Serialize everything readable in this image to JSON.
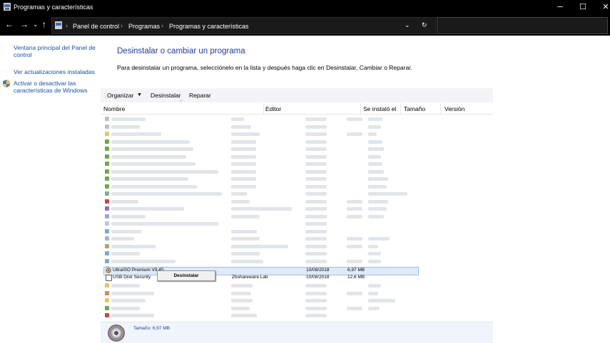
{
  "window": {
    "title": "Programas y características",
    "minimize": "─",
    "maximize": "☐",
    "close": "✕"
  },
  "nav": {
    "back": "←",
    "forward": "→",
    "history": "⌄",
    "up": "↑",
    "refresh": "↻",
    "dropdown": "⌄"
  },
  "breadcrumb": [
    "Panel de control",
    "Programas",
    "Programas y características"
  ],
  "sidebar": {
    "items": [
      {
        "label": "Ventana principal del Panel de",
        "label2": "control"
      },
      {
        "label": "Ver actualizaciones instaladas"
      },
      {
        "label": "Activar o desactivar las",
        "label2": "características de Windows",
        "icon": "shield-icon"
      }
    ]
  },
  "main": {
    "heading": "Desinstalar o cambiar un programa",
    "subtitle": "Para desinstalar un programa, selecciónelo en la lista y después haga clic en Desinstalar, Cambiar o Reparar."
  },
  "toolbar": {
    "organize": "Organizar",
    "uninstall": "Desinstalar",
    "repair": "Reparar"
  },
  "columns": {
    "name": "Nombre",
    "publisher": "Editor",
    "installed": "Se instaló el",
    "size": "Tamaño",
    "version": "Versión"
  },
  "rows": [
    {
      "name": "UltraISO Premium V9.45",
      "publisher": "",
      "date": "10/08/2018",
      "size": "6,97 MB"
    },
    {
      "name": "USB Disk Security",
      "publisher": "Zbshareware Lab",
      "date": "10/08/2018",
      "size": "12,6 MB"
    }
  ],
  "context_menu": {
    "uninstall": "Desinstalar"
  },
  "status": {
    "text": "Tamaño: 6,97 MB"
  },
  "colors": {
    "accent": "#1e3c94",
    "selection": "#dfe9f7",
    "link": "#1a4fa0"
  }
}
